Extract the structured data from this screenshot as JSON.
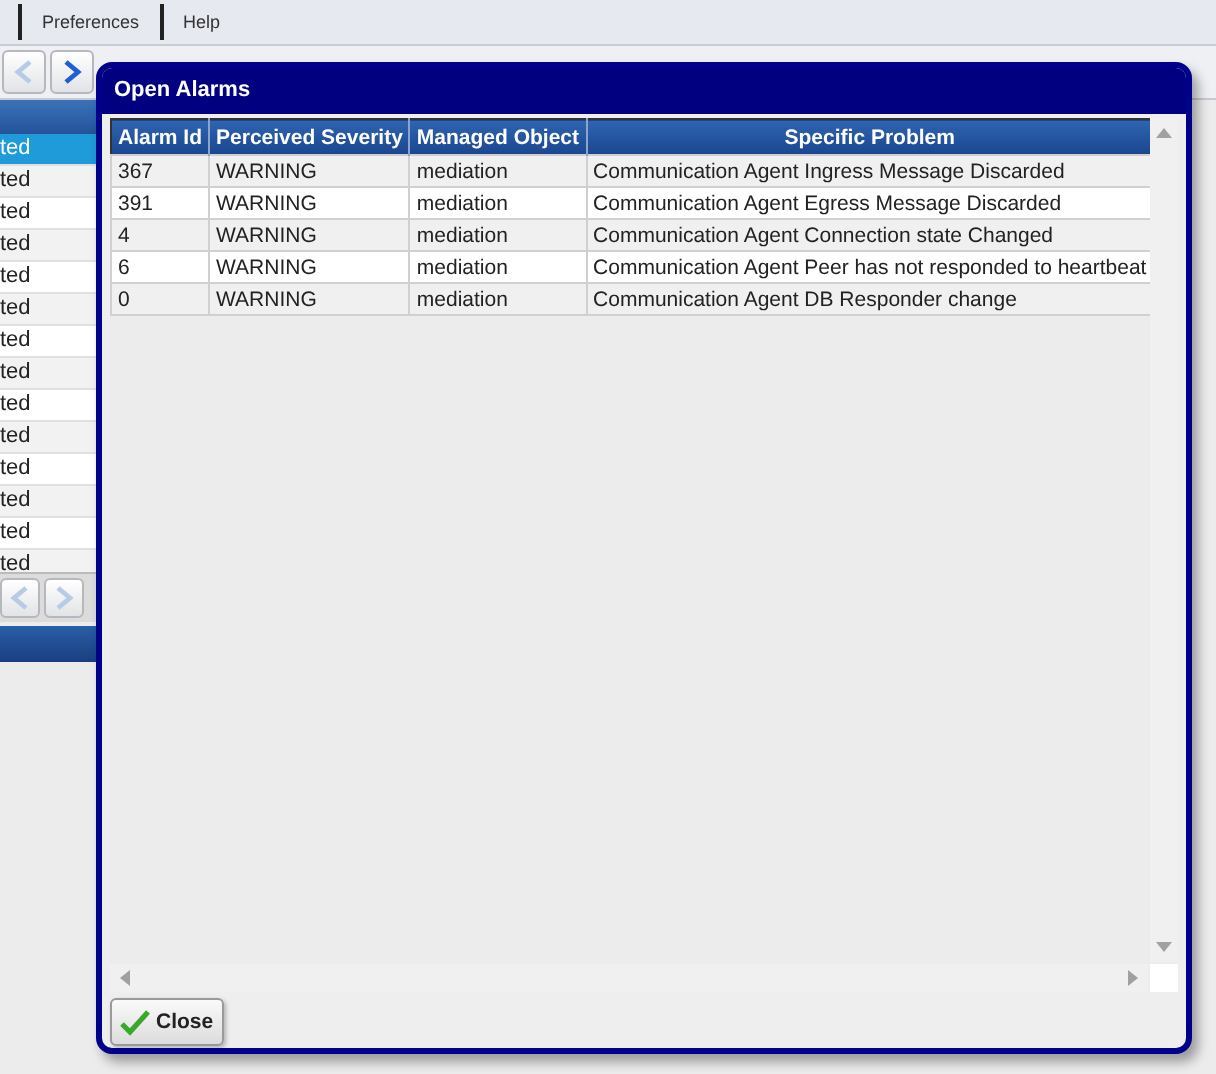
{
  "menu_bar": {
    "items": [
      "Preferences",
      "Help"
    ]
  },
  "toolbar": {
    "buttons": [
      {
        "kind": "back",
        "disabled": true
      },
      {
        "kind": "forward",
        "disabled": false
      }
    ]
  },
  "background_table": {
    "rows": [
      {
        "text": "ted",
        "selected": true
      },
      {
        "text": "ted",
        "selected": false
      },
      {
        "text": "ted",
        "selected": false
      },
      {
        "text": "ted",
        "selected": false
      },
      {
        "text": "ted",
        "selected": false
      },
      {
        "text": "ted",
        "selected": false
      },
      {
        "text": "ted",
        "selected": false
      },
      {
        "text": "ted",
        "selected": false
      },
      {
        "text": "ted",
        "selected": false
      },
      {
        "text": "ted",
        "selected": false
      },
      {
        "text": "ted",
        "selected": false
      },
      {
        "text": "ted",
        "selected": false
      },
      {
        "text": "ted",
        "selected": false
      },
      {
        "text": "ted",
        "selected": false
      }
    ],
    "pager": [
      {
        "kind": "back",
        "disabled": true
      },
      {
        "kind": "forward",
        "disabled": true
      }
    ]
  },
  "dialog": {
    "title": "Open Alarms",
    "table": {
      "columns": [
        "Alarm Id",
        "Perceived Severity",
        "Managed Object",
        "Specific Problem"
      ],
      "rows": [
        [
          "367",
          "WARNING",
          "mediation",
          "Communication Agent Ingress Message Discarded"
        ],
        [
          "391",
          "WARNING",
          "mediation",
          "Communication Agent Egress Message Discarded"
        ],
        [
          "4",
          "WARNING",
          "mediation",
          "Communication Agent Connection state Changed"
        ],
        [
          "6",
          "WARNING",
          "mediation",
          "Communication Agent Peer has not responded to heartbeat"
        ],
        [
          "0",
          "WARNING",
          "mediation",
          "Communication Agent DB Responder change"
        ]
      ]
    },
    "buttons": [
      {
        "label": "Close",
        "kind": "ok"
      }
    ]
  }
}
